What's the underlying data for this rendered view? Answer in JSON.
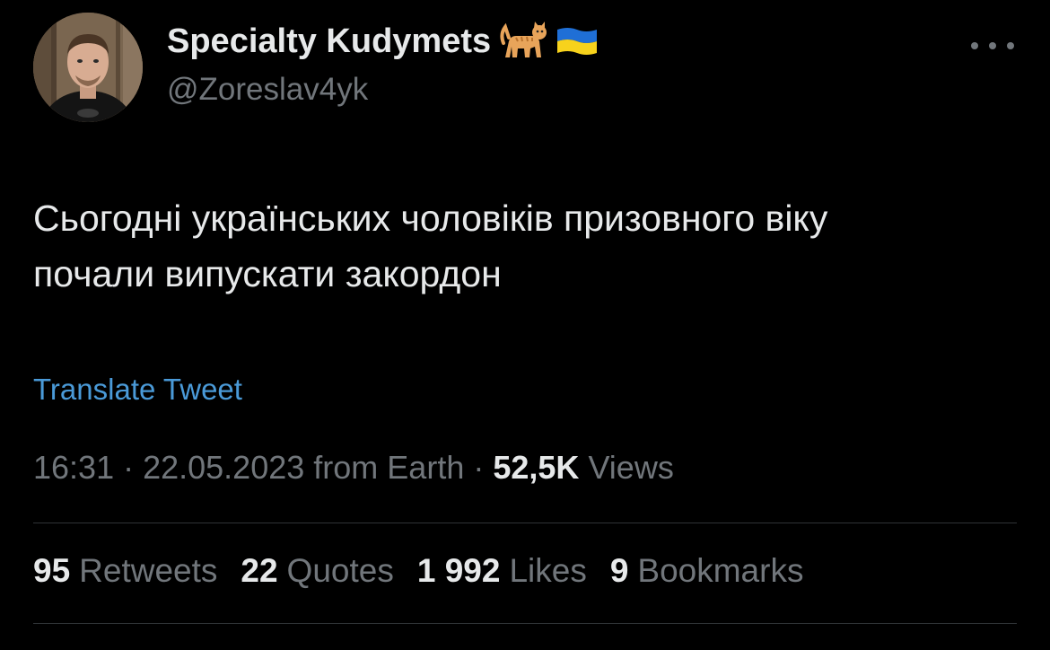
{
  "author": {
    "display_name": "Specialty Kudymets",
    "handle": "@Zoreslav4yk",
    "badges": [
      "cat-emoji",
      "ukraine-flag-emoji"
    ]
  },
  "tweet": {
    "text_line1": "Сьогодні українських чоловіків призовного віку",
    "text_line2": "почали випускати закордон",
    "translate_label": "Translate Tweet"
  },
  "meta": {
    "time": "16:31",
    "separator": " · ",
    "date": "22.05.2023",
    "source": "from Earth",
    "views_count": "52,5K",
    "views_label": "Views"
  },
  "stats": {
    "retweets_count": "95",
    "retweets_label": "Retweets",
    "quotes_count": "22",
    "quotes_label": "Quotes",
    "likes_count": "1 992",
    "likes_label": "Likes",
    "bookmarks_count": "9",
    "bookmarks_label": "Bookmarks"
  },
  "colors": {
    "background": "#000000",
    "primary_text": "#e7e9ea",
    "secondary_text": "#71767b",
    "link": "#4a9ad8",
    "divider": "#2f3336"
  }
}
